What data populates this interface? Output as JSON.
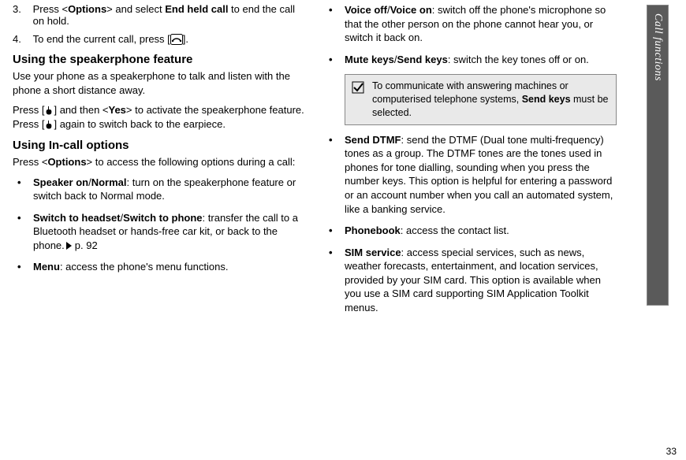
{
  "sideTab": "Call functions",
  "pageNumber": "33",
  "left": {
    "step3": {
      "num": "3.",
      "pre": "Press <",
      "opt": "Options",
      "mid": "> and select ",
      "eh": "End held call",
      "post": " to end the call on hold."
    },
    "step4": {
      "num": "4.",
      "pre": "To end the current call, press [",
      "post": "]."
    },
    "h_speaker": "Using the speakerphone feature",
    "p_speaker": "Use your phone as a speakerphone to talk and listen with the phone a short distance away.",
    "p_speaker2a": "Press [",
    "p_speaker2b": "] and then <",
    "p_speaker2_yes": "Yes",
    "p_speaker2c": "> to activate the speakerphone feature. Press [",
    "p_speaker2d": "] again to switch back to the earpiece.",
    "h_incall": "Using In-call options",
    "p_incall": "Press <",
    "p_incall_opt": "Options",
    "p_incall2": "> to access the following options during a call:",
    "li1": {
      "b": "Speaker on",
      "sep": "/",
      "b2": "Normal",
      "rest": ": turn on the speakerphone feature or switch back to Normal mode."
    },
    "li2": {
      "b": "Switch to headset",
      "sep": "/",
      "b2": "Switch to phone",
      "rest": ": transfer the call to a Bluetooth headset or hands-free car kit, or back to the phone.",
      "ref": "p. 92"
    },
    "li3": {
      "b": "Menu",
      "rest": ": access the phone's menu functions."
    }
  },
  "right": {
    "li1": {
      "b": "Voice off",
      "sep": "/",
      "b2": "Voice on",
      "rest": ": switch off the phone's microphone so that the other person on the phone cannot hear you, or switch it back on."
    },
    "li2": {
      "b": "Mute keys",
      "sep": "/",
      "b2": "Send keys",
      "rest": ": switch the key tones off or on."
    },
    "note": {
      "pre": "To communicate with answering machines or computerised telephone systems, ",
      "bold": "Send keys",
      "post": " must be selected."
    },
    "li3": {
      "b": "Send DTMF",
      "rest": ": send the DTMF (Dual tone multi-frequency) tones as a group. The DTMF tones are the tones used in phones for tone dialling, sounding when you press the number keys. This option is helpful for entering a password or an account number when you call an automated system, like a banking service."
    },
    "li4": {
      "b": "Phonebook",
      "rest": ": access the contact list."
    },
    "li5": {
      "b": "SIM service",
      "rest": ": access special services, such as news, weather forecasts, entertainment, and location services, provided by your SIM card. This option is available when you use a SIM card supporting SIM Application Toolkit menus."
    }
  }
}
